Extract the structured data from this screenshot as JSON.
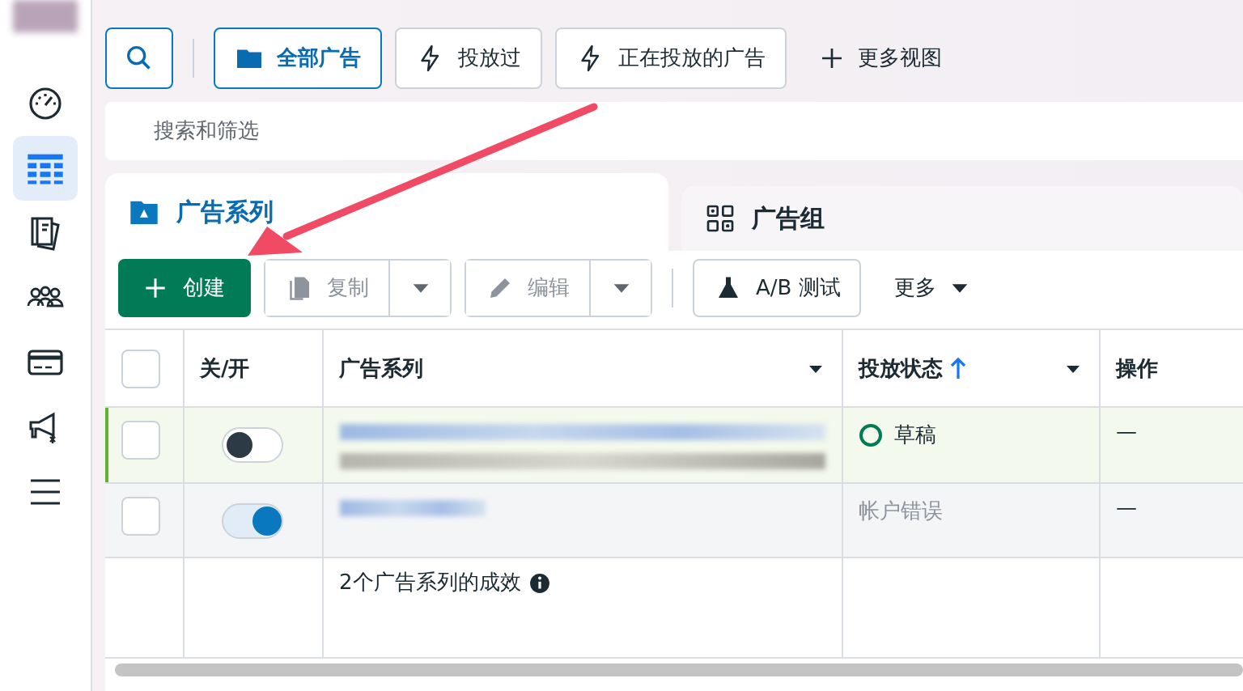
{
  "sidebar": {
    "items": [
      {
        "kind": "gauge",
        "selected": false
      },
      {
        "kind": "table",
        "selected": true
      },
      {
        "kind": "book",
        "selected": false
      },
      {
        "kind": "people",
        "selected": false
      },
      {
        "kind": "card",
        "selected": false
      },
      {
        "kind": "megaphone",
        "selected": false
      },
      {
        "kind": "menu",
        "selected": false
      }
    ]
  },
  "view_tabs": [
    {
      "label": "全部广告",
      "kind": "folder",
      "selected": true
    },
    {
      "label": "投放过",
      "kind": "bolt",
      "selected": false
    },
    {
      "label": "正在投放的广告",
      "kind": "bolt",
      "selected": false
    }
  ],
  "more_views": {
    "label": "更多视图"
  },
  "search": {
    "placeholder": "搜索和筛选"
  },
  "level_tabs": [
    {
      "label": "广告系列",
      "kind": "campaign",
      "selected": true
    },
    {
      "label": "广告组",
      "kind": "adset",
      "selected": false
    }
  ],
  "actions": {
    "create": {
      "label": "创建"
    },
    "copy": {
      "label": "复制",
      "disabled": true
    },
    "edit": {
      "label": "编辑",
      "disabled": true
    },
    "ab_test": {
      "label": "A/B 测试"
    },
    "more": {
      "label": "更多"
    }
  },
  "table": {
    "select_all": {
      "checked": false
    },
    "columns": [
      {
        "label": "关/开",
        "menu": false,
        "sort_ascending": false
      },
      {
        "label": "广告系列",
        "menu": true,
        "sort_ascending": false
      },
      {
        "label": "投放状态",
        "menu": true,
        "sort_ascending": true
      },
      {
        "label": "操作",
        "menu": false,
        "sort_ascending": false
      }
    ],
    "rows": [
      {
        "checked": false,
        "on": false,
        "highlighted": true,
        "status": "草稿",
        "kind": "draft",
        "actions": "—"
      },
      {
        "checked": false,
        "on": true,
        "highlighted": false,
        "status": "帐户错误",
        "kind": "error",
        "actions": "—"
      }
    ],
    "footer": "2个广告系列的成效"
  }
}
